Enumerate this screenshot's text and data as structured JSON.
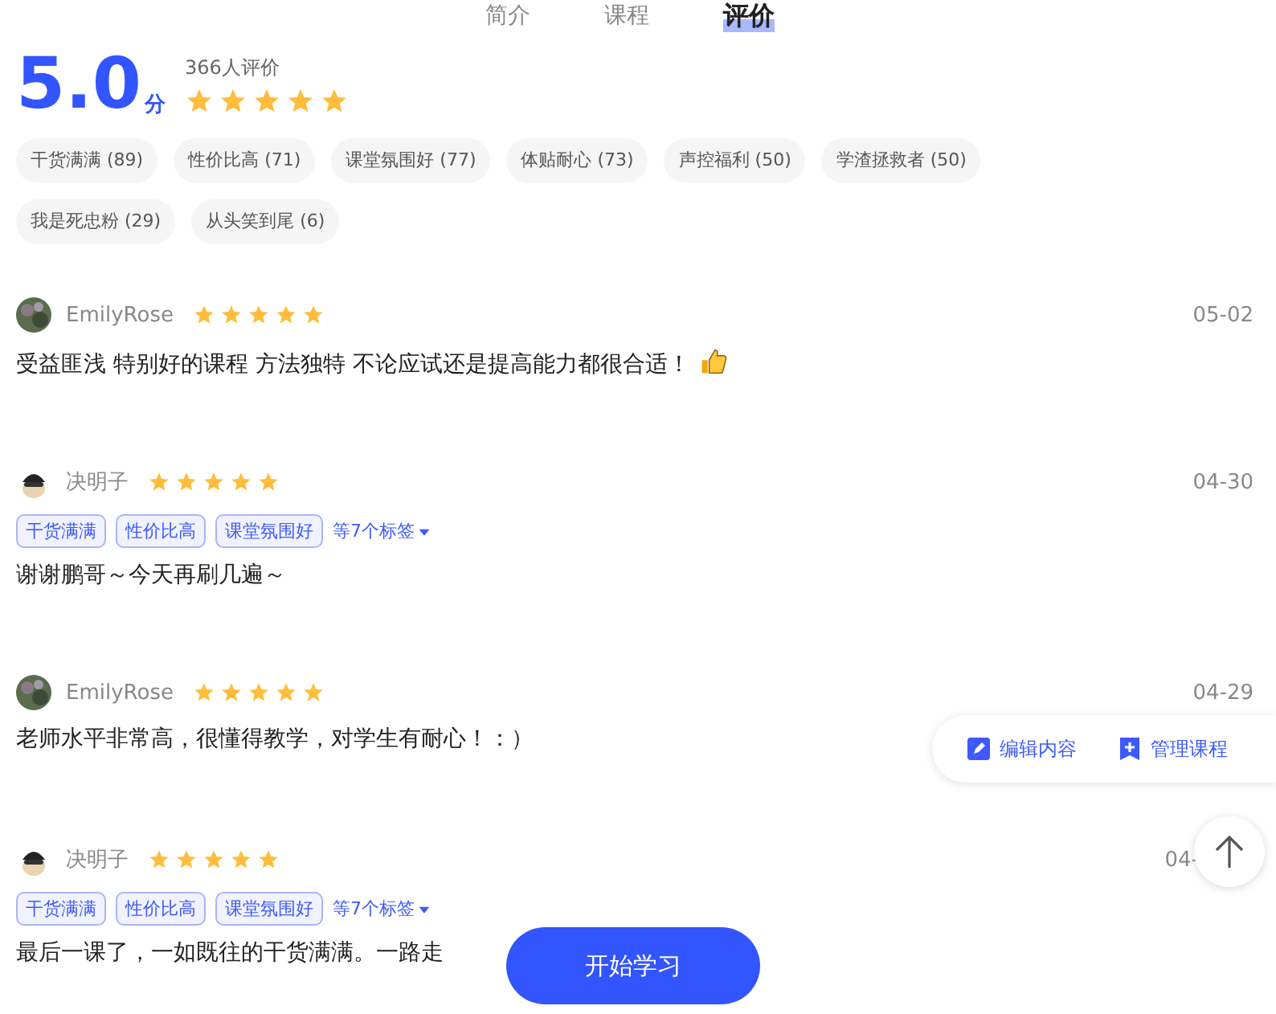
{
  "tabs": [
    {
      "label": "简介",
      "selected": false
    },
    {
      "label": "课程",
      "selected": false
    },
    {
      "label": "评价",
      "selected": true
    }
  ],
  "summary": {
    "score": "5.0",
    "unit": "分",
    "count": "366人评价",
    "stars": 5
  },
  "tag_filters": [
    {
      "label": "干货满满 (89)"
    },
    {
      "label": "性价比高 (71)"
    },
    {
      "label": "课堂氛围好 (77)"
    },
    {
      "label": "体贴耐心 (73)"
    },
    {
      "label": "声控福利 (50)"
    },
    {
      "label": "学渣拯救者 (50)"
    },
    {
      "label": "我是死忠粉 (29)"
    },
    {
      "label": "从头笑到尾 (6)"
    }
  ],
  "reviews": [
    {
      "user": "EmilyRose",
      "kind": "photo",
      "stars": 5,
      "date": "05-02",
      "text": "受益匪浅 特别好的课程 方法独特 不论应试还是提高能力都很合适！",
      "thumbs_up": true
    },
    {
      "user": "决明子",
      "kind": "cartoon",
      "stars": 5,
      "date": "04-30",
      "tags": [
        "干货满满",
        "性价比高",
        "课堂氛围好"
      ],
      "more_tags": "等7个标签",
      "text": "谢谢鹏哥～今天再刷几遍～",
      "thumbs_up": false
    },
    {
      "user": "EmilyRose",
      "kind": "photo",
      "stars": 5,
      "date": "04-29",
      "text": "老师水平非常高，很懂得教学，对学生有耐心！：）",
      "thumbs_up": false
    },
    {
      "user": "决明子",
      "kind": "cartoon",
      "stars": 5,
      "date": "04-",
      "tags": [
        "干货满满",
        "性价比高",
        "课堂氛围好"
      ],
      "more_tags": "等7个标签",
      "text": "最后一课了，一如既往的干货满满。一路走",
      "thumbs_up": false
    }
  ],
  "floating_actions": [
    {
      "kind": "edit",
      "label": "编辑内容"
    },
    {
      "kind": "add",
      "label": "管理课程"
    }
  ],
  "start_button": "开始学习"
}
